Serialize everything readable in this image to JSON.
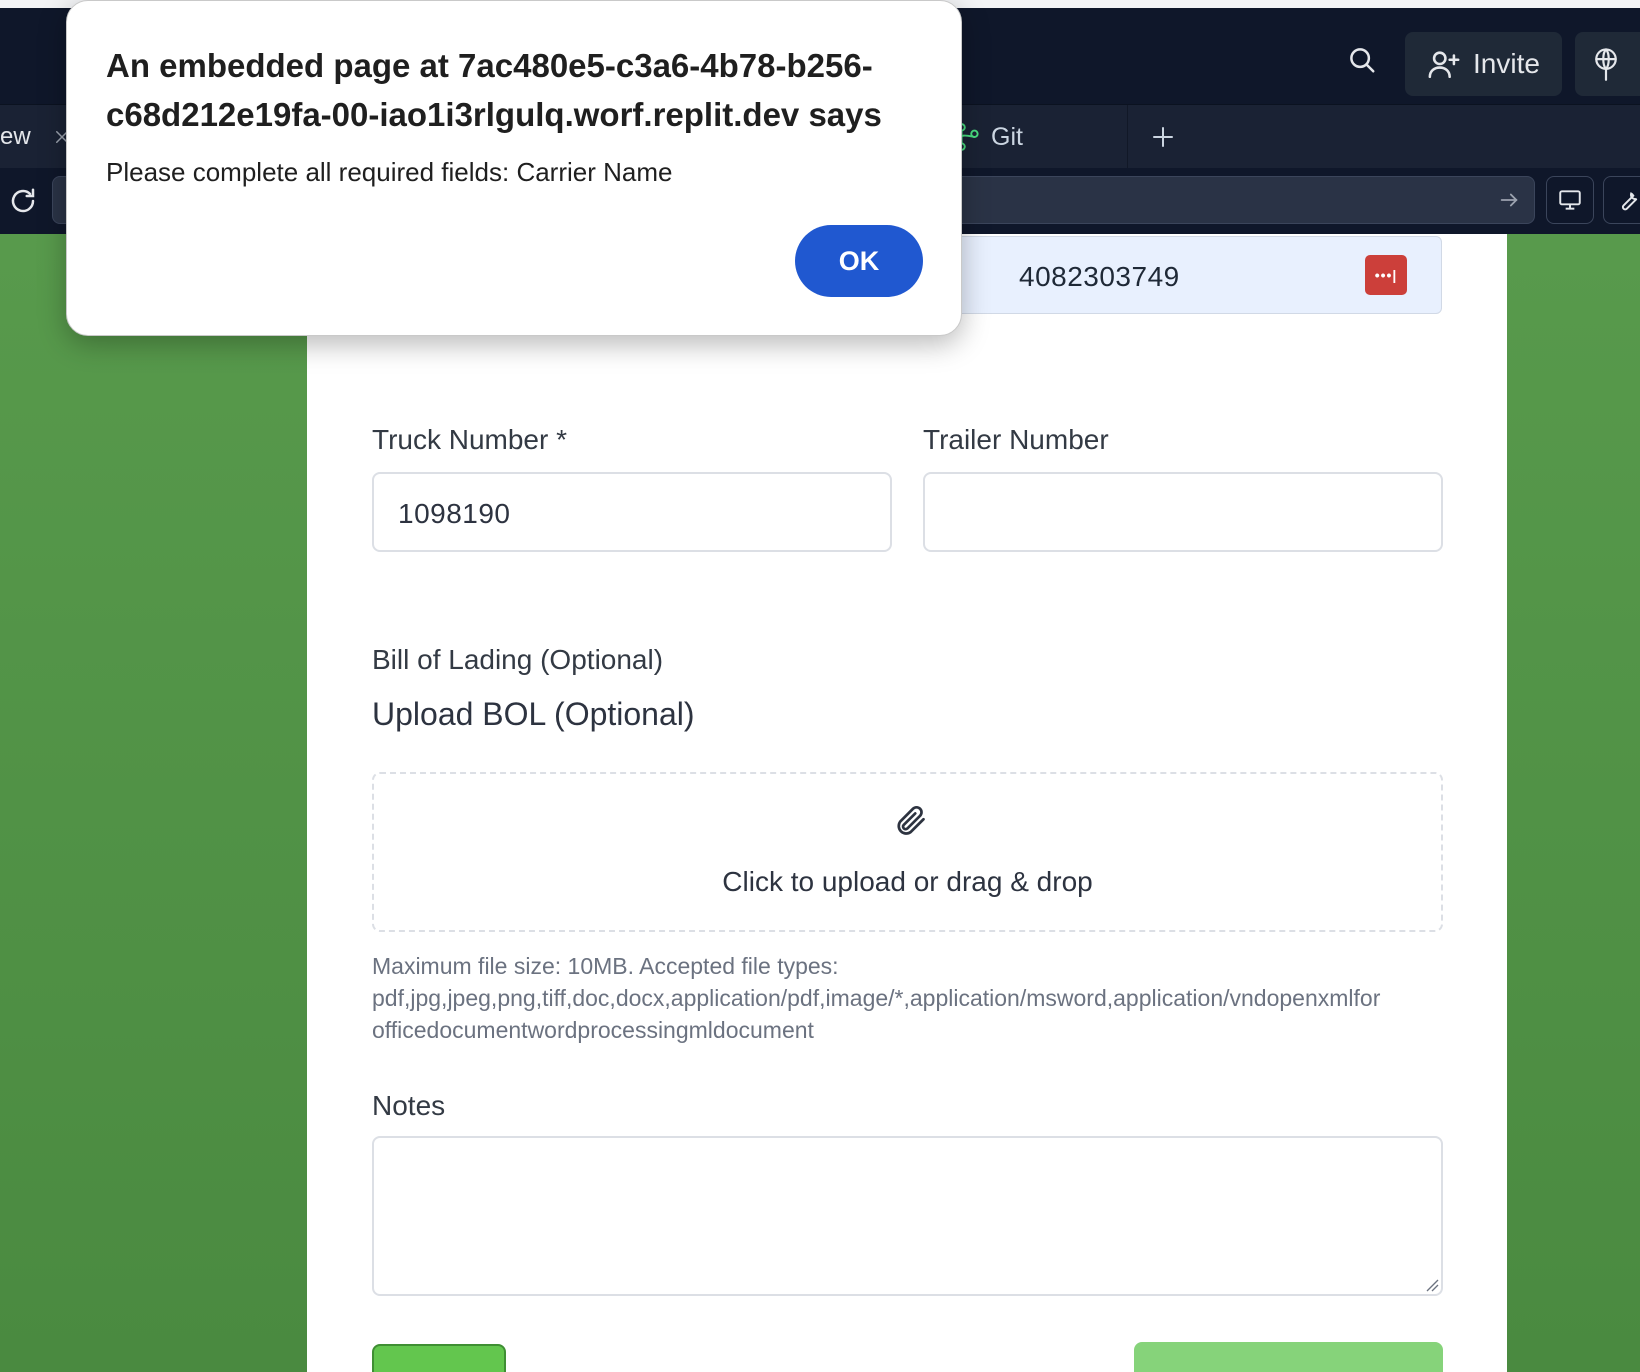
{
  "ide": {
    "invite_label": "Invite",
    "tabs": [
      {
        "label": "ew",
        "close_icon": "close-icon"
      },
      {
        "label": "Git",
        "icon": "git-icon"
      }
    ],
    "add_tab_icon": "plus-icon"
  },
  "form": {
    "prev_value": "4082303749",
    "truck_number_label": "Truck Number *",
    "truck_number_value": "1098190",
    "trailer_number_label": "Trailer Number",
    "trailer_number_value": "",
    "bol_label": "Bill of Lading (Optional)",
    "bol_heading": "Upload BOL (Optional)",
    "dropzone_text": "Click to upload or drag & drop",
    "file_help_lines": [
      "Maximum file size: 10MB. Accepted file types:",
      "pdf,jpg,jpeg,png,tiff,doc,docx,application/pdf,image/*,application/msword,application/vndopenxmlfor",
      "officedocumentwordprocessingmldocument"
    ],
    "notes_label": "Notes",
    "notes_value": ""
  },
  "dialog": {
    "title_lines": [
      "An embedded page at 7ac480e5-c3a6-4b78-b256-",
      "c68d212e19fa-00-iao1i3rlgulq.worf.replit.dev says"
    ],
    "message": "Please complete all required fields: Carrier Name",
    "ok_label": "OK"
  },
  "colors": {
    "ide_bg": "#0f172a",
    "page_green": "#4f8f45",
    "ok_blue": "#2058d0",
    "password_manager_red": "#cc3f3a"
  }
}
